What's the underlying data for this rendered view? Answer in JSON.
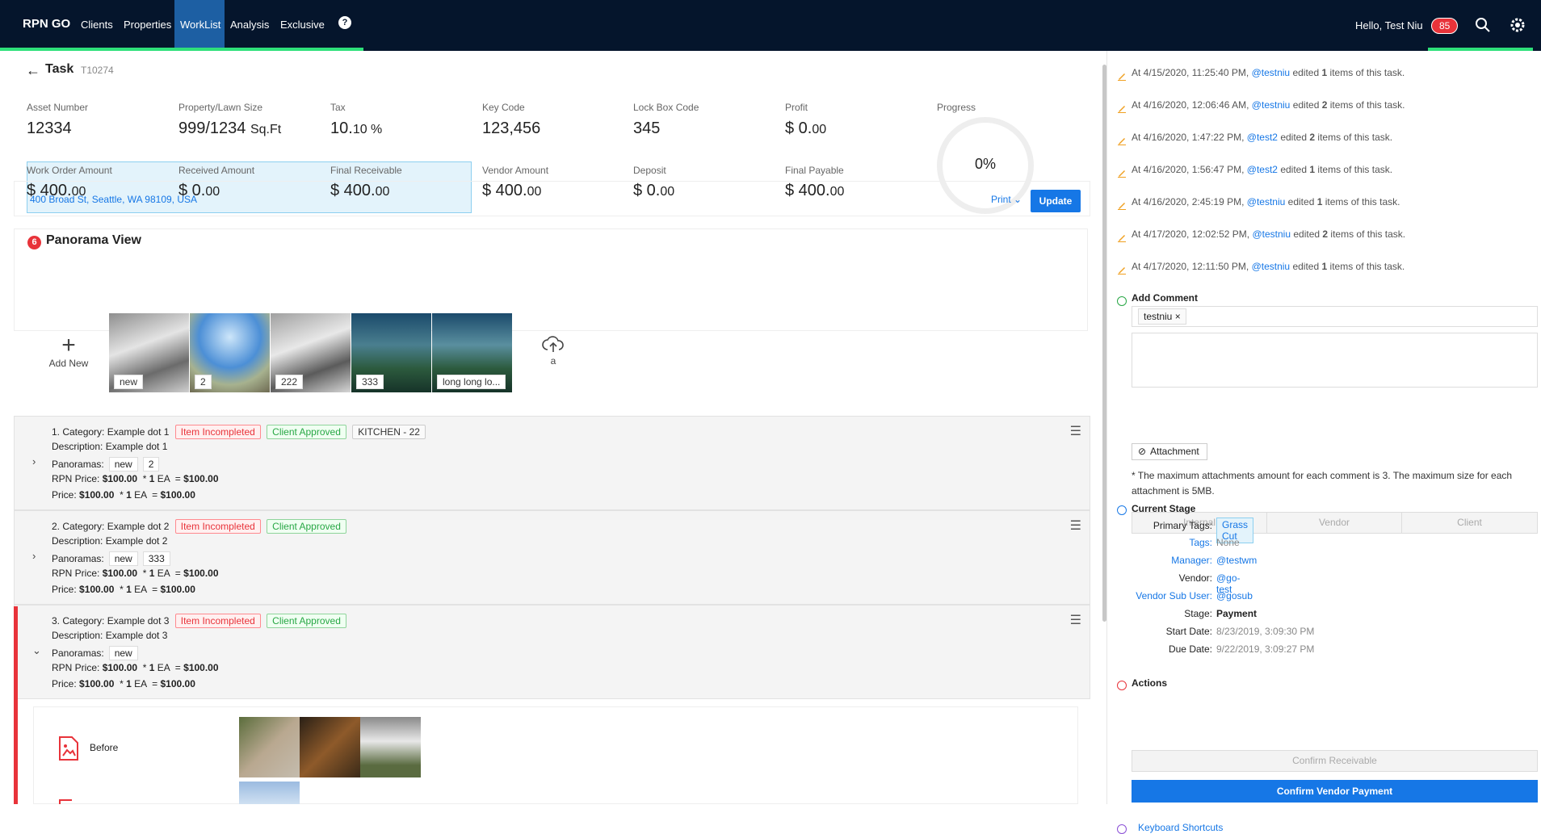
{
  "nav": {
    "brand": "RPN GO",
    "items": [
      "Clients",
      "Properties",
      "WorkList",
      "Analysis",
      "Exclusive"
    ],
    "help": "?",
    "hello": "Hello, Test Niu",
    "badge_count": "85"
  },
  "task": {
    "title": "Task",
    "id": "T10274",
    "stats": [
      {
        "label": "Asset Number",
        "value": "12334",
        "unit": ""
      },
      {
        "label": "Property/Lawn Size",
        "value": "999/1234",
        "unit": "Sq.Ft"
      },
      {
        "label": "Tax",
        "value": "10.",
        "unit": "10 %"
      },
      {
        "label": "Key Code",
        "value": "123,456",
        "unit": ""
      },
      {
        "label": "Lock Box Code",
        "value": "345",
        "unit": ""
      },
      {
        "label": "Profit",
        "value": "$ 0.",
        "unit": "00"
      },
      {
        "label": "Work Order Amount",
        "value": "$ 400.",
        "unit": "00"
      },
      {
        "label": "Received Amount",
        "value": "$ 0.",
        "unit": "00"
      },
      {
        "label": "Final Receivable",
        "value": "$ 400.",
        "unit": "00"
      },
      {
        "label": "Vendor Amount",
        "value": "$ 400.",
        "unit": "00"
      },
      {
        "label": "Deposit",
        "value": "$ 0.",
        "unit": "00"
      },
      {
        "label": "Final Payable",
        "value": "$ 400.",
        "unit": "00"
      }
    ],
    "progress_label": "Progress",
    "progress_value": "0%",
    "address": "400 Broad St, Seattle, WA 98109, USA",
    "print": "Print",
    "update": "Update"
  },
  "panorama": {
    "count": "6",
    "title": "Panorama View",
    "add_new": "Add New",
    "thumbs": [
      "new",
      "2",
      "222",
      "333",
      "long long lo..."
    ],
    "upload_label": "a"
  },
  "items": [
    {
      "category": "1. Category: Example dot 1",
      "tags": [
        "Item Incompleted",
        "Client Approved",
        "KITCHEN - 22"
      ],
      "description": "Description: Example dot 1",
      "panoramas_label": "Panoramas:",
      "panoramas": [
        "new",
        "2"
      ],
      "rpn_price": "$100.00",
      "rpn_qty": "1",
      "rpn_unit": "EA",
      "rpn_total": "$100.00",
      "price": "$100.00",
      "qty": "1",
      "unit": "EA",
      "total": "$100.00",
      "expanded": false
    },
    {
      "category": "2. Category: Example dot 2",
      "tags": [
        "Item Incompleted",
        "Client Approved"
      ],
      "description": "Description: Example dot 2",
      "panoramas_label": "Panoramas:",
      "panoramas": [
        "new",
        "333"
      ],
      "rpn_price": "$100.00",
      "rpn_qty": "1",
      "rpn_unit": "EA",
      "rpn_total": "$100.00",
      "price": "$100.00",
      "qty": "1",
      "unit": "EA",
      "total": "$100.00",
      "expanded": false
    },
    {
      "category": "3. Category: Example dot 3",
      "tags": [
        "Item Incompleted",
        "Client Approved"
      ],
      "description": "Description: Example dot 3",
      "panoramas_label": "Panoramas:",
      "panoramas": [
        "new"
      ],
      "rpn_price": "$100.00",
      "rpn_qty": "1",
      "rpn_unit": "EA",
      "rpn_total": "$100.00",
      "price": "$100.00",
      "qty": "1",
      "unit": "EA",
      "total": "$100.00",
      "expanded": true
    }
  ],
  "labels": {
    "rpn_price": "RPN Price:",
    "price": "Price:",
    "before": "Before"
  },
  "history": [
    {
      "time": "At 4/15/2020, 11:25:40 PM,",
      "user": "@testniu",
      "count": "1"
    },
    {
      "time": "At 4/16/2020, 12:06:46 AM,",
      "user": "@testniu",
      "count": "2"
    },
    {
      "time": "At 4/16/2020, 1:47:22 PM,",
      "user": "@test2",
      "count": "2"
    },
    {
      "time": "At 4/16/2020, 1:56:47 PM,",
      "user": "@test2",
      "count": "1"
    },
    {
      "time": "At 4/16/2020, 2:45:19 PM,",
      "user": "@testniu",
      "count": "1"
    },
    {
      "time": "At 4/17/2020, 12:02:52 PM,",
      "user": "@testniu",
      "count": "2"
    },
    {
      "time": "At 4/17/2020, 12:11:50 PM,",
      "user": "@testniu",
      "count": "1"
    }
  ],
  "history_text": {
    "edited": "edited",
    "items": "items of this task."
  },
  "comment": {
    "title": "Add Comment",
    "mention": "testniu",
    "attachment": "Attachment",
    "note": "* The maximum attachments amount for each comment is 3. The maximum size for each attachment is 5MB.",
    "audiences": [
      "Internal",
      "Vendor",
      "Client"
    ]
  },
  "stage": {
    "title": "Current Stage",
    "rows": [
      {
        "label": "Primary Tags:",
        "value": "Grass Cut"
      },
      {
        "label": "Tags:",
        "value": "None"
      },
      {
        "label": "Manager:",
        "value": "@testwm"
      },
      {
        "label": "Vendor:",
        "value": "@go-test"
      },
      {
        "label": "Vendor Sub User:",
        "value": "@gosub"
      },
      {
        "label": "Stage:",
        "value": "Payment"
      },
      {
        "label": "Start Date:",
        "value": "8/23/2019, 3:09:30 PM"
      },
      {
        "label": "Due Date:",
        "value": "9/22/2019, 3:09:27 PM"
      }
    ]
  },
  "actions": {
    "title": "Actions",
    "confirm_receivable": "Confirm Receivable",
    "confirm_vendor_payment": "Confirm Vendor Payment",
    "keyboard_shortcuts": "Keyboard Shortcuts"
  },
  "colors": {
    "nav_bg": "#05152c",
    "accent": "#1677e6",
    "active_nav": "#1d5fa3",
    "green_line": "#2fe07a",
    "red": "#e8333a"
  }
}
